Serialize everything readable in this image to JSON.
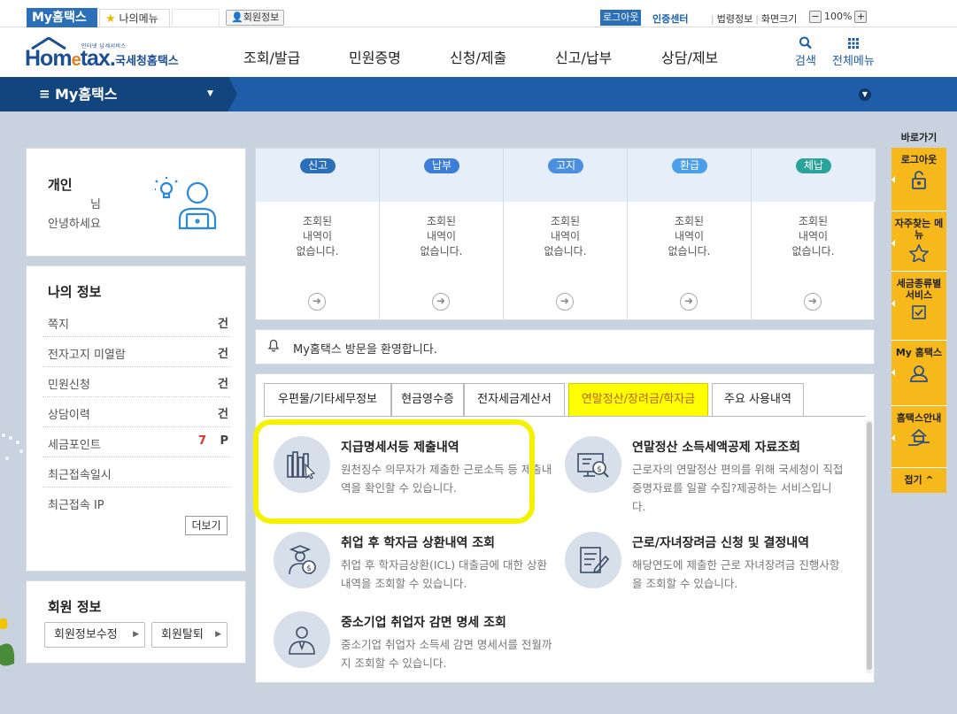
{
  "topbar": {
    "myhome_tab": "My홈택스",
    "my_menu": "나의메뉴",
    "member_info": "회원정보",
    "logout": "로그아웃",
    "auth_center": "인증센터",
    "law_info": "법령정보",
    "screen_size": "화면크기",
    "zoom_minus": "−",
    "zoom_value": "100%",
    "zoom_plus": "+"
  },
  "header": {
    "logo_subtitle": "인터넷 납세서비스",
    "logo_home": "Hom",
    "logo_e": "e",
    "logo_tax": "tax.",
    "logo_kr": "국세청홈택스",
    "nav": [
      "조회/발급",
      "민원증명",
      "신청/제출",
      "신고/납부",
      "상담/제보"
    ],
    "search_label": "검색",
    "all_menu_label": "전체메뉴"
  },
  "bluebar": {
    "title": "My홈택스"
  },
  "person": {
    "type": "개인",
    "name_suffix": "님",
    "greeting": "안녕하세요"
  },
  "myinfo": {
    "title": "나의 정보",
    "rows": [
      {
        "label": "쪽지",
        "value": "건"
      },
      {
        "label": "전자고지 미열람",
        "value": "건"
      },
      {
        "label": "민원신청",
        "value": "건"
      },
      {
        "label": "상담이력",
        "value": "건"
      },
      {
        "label": "세금포인트",
        "points": "7",
        "value": "P"
      },
      {
        "label": "최근접속일시",
        "value": ""
      },
      {
        "label": "최근접속 IP",
        "value": ""
      }
    ],
    "more": "더보기"
  },
  "member": {
    "title": "회원 정보",
    "edit": "회원정보수정",
    "withdraw": "회원탈퇴"
  },
  "status": [
    {
      "badge": "신고",
      "color": "#2a6fb7",
      "msg": [
        "조회된",
        "내역이",
        "없습니다."
      ]
    },
    {
      "badge": "납부",
      "color": "#3b7dd8",
      "msg": [
        "조회된",
        "내역이",
        "없습니다."
      ]
    },
    {
      "badge": "고지",
      "color": "#4a8fe0",
      "msg": [
        "조회된",
        "내역이",
        "없습니다."
      ]
    },
    {
      "badge": "환급",
      "color": "#4a9fe8",
      "msg": [
        "조회된",
        "내역이",
        "없습니다."
      ]
    },
    {
      "badge": "체납",
      "color": "#2aa39a",
      "msg": [
        "조회된",
        "내역이",
        "없습니다."
      ]
    }
  ],
  "welcome": "My홈택스 방문을 환영합니다.",
  "tabs": [
    "우편물/기타세무정보",
    "현금영수증",
    "전자세금계산서",
    "연말정산/장려금/학자금",
    "주요 사용내역"
  ],
  "services": [
    {
      "title": "지급명세서등 제출내역",
      "desc": "원천징수 의무자가 제출한 근로소득 등 제출내역을 확인할 수 있습니다.",
      "icon": "books-icon"
    },
    {
      "title": "연말정산 소득세액공제 자료조회",
      "desc": "근로자의 연말정산 편의를 위해 국세청이 직접 증명자료를 일괄 수집?제공하는 서비스입니다.",
      "icon": "monitor-coin-icon"
    },
    {
      "title": "취업 후 학자금 상환내역 조회",
      "desc": "취업 후 학자금상환(ICL) 대출금에 대한 상환내역을 조회할 수 있습니다.",
      "icon": "graduate-icon"
    },
    {
      "title": "근로/자녀장려금 신청 및 결정내역",
      "desc": "해당연도에 제출한 근로 자녀장려금 진행사항을 조회할 수 있습니다.",
      "icon": "document-pen-icon"
    },
    {
      "title": "중소기업 취업자 감면 명세 조회",
      "desc": "중소기업 취업자 소득세 감면 명세서를 전월까지 조회할 수 있습니다.",
      "icon": "worker-icon"
    }
  ],
  "quick": {
    "title": "바로가기",
    "items": [
      {
        "label": "로그아웃",
        "icon": "unlock-icon"
      },
      {
        "label": "자주찾는 메뉴",
        "icon": "star-icon"
      },
      {
        "label": "세금종류별 서비스",
        "icon": "checkbox-icon"
      },
      {
        "label": "My 홈택스",
        "icon": "user-icon"
      },
      {
        "label": "홈택스안내",
        "icon": "house-hand-icon"
      }
    ],
    "fold": "접기 ^"
  }
}
